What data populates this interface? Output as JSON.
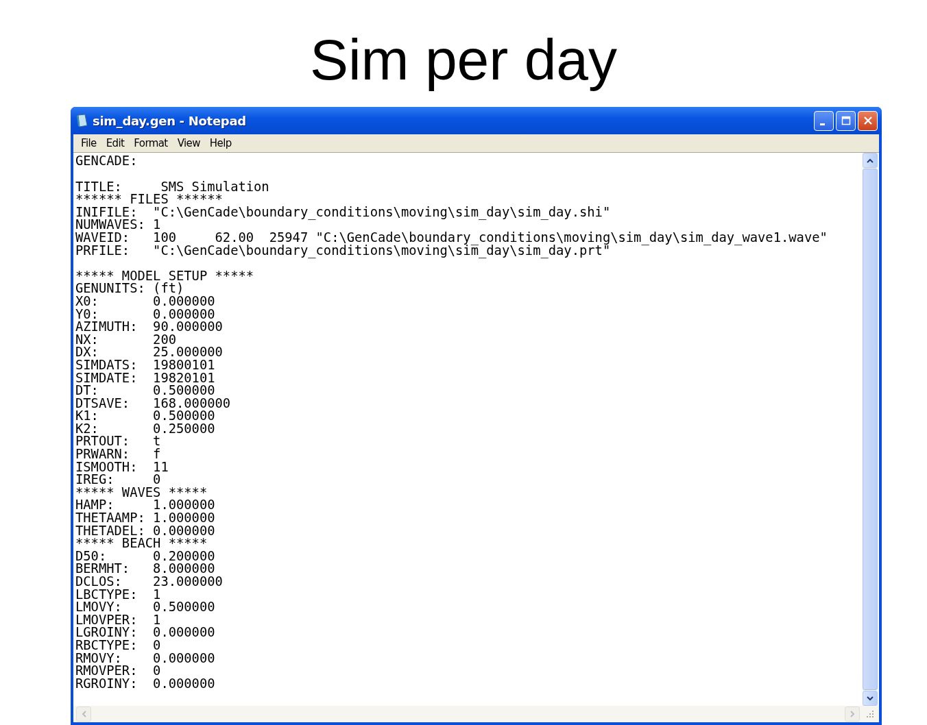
{
  "slide": {
    "title": "Sim per day"
  },
  "window": {
    "title": "sim_day.gen - Notepad"
  },
  "menu": [
    "File",
    "Edit",
    "Format",
    "View",
    "Help"
  ],
  "document": {
    "paragraphs": [
      [
        "GENCADE:"
      ],
      [
        "TITLE:     SMS Simulation",
        "****** FILES ******",
        "INIFILE:  \"C:\\GenCade\\boundary_conditions\\moving\\sim_day\\sim_day.shi\"",
        "NUMWAVES: 1",
        "WAVEID:   100     62.00  25947 \"C:\\GenCade\\boundary_conditions\\moving\\sim_day\\sim_day_wave1.wave\"",
        "PRFILE:   \"C:\\GenCade\\boundary_conditions\\moving\\sim_day\\sim_day.prt\""
      ],
      [
        "***** MODEL SETUP *****",
        "GENUNITS: (ft)",
        "X0:       0.000000",
        "Y0:       0.000000",
        "AZIMUTH:  90.000000",
        "NX:       200",
        "DX:       25.000000",
        "SIMDATS:  19800101",
        "SIMDATE:  19820101",
        "DT:       0.500000",
        "DTSAVE:   168.000000",
        "K1:       0.500000",
        "K2:       0.250000",
        "PRTOUT:   t",
        "PRWARN:   f",
        "ISMOOTH:  11",
        "IREG:     0",
        "***** WAVES *****",
        "HAMP:     1.000000",
        "THETAAMP: 1.000000",
        "THETADEL: 0.000000",
        "***** BEACH *****",
        "D50:      0.200000",
        "BERMHT:   8.000000",
        "DCLOS:    23.000000",
        "LBCTYPE:  1",
        "LMOVY:    0.500000",
        "LMOVPER:  1",
        "LGROINY:  0.000000",
        "RBCTYPE:  0",
        "RMOVY:    0.000000",
        "RMOVPER:  0",
        "RGROINY:  0.000000"
      ]
    ]
  }
}
